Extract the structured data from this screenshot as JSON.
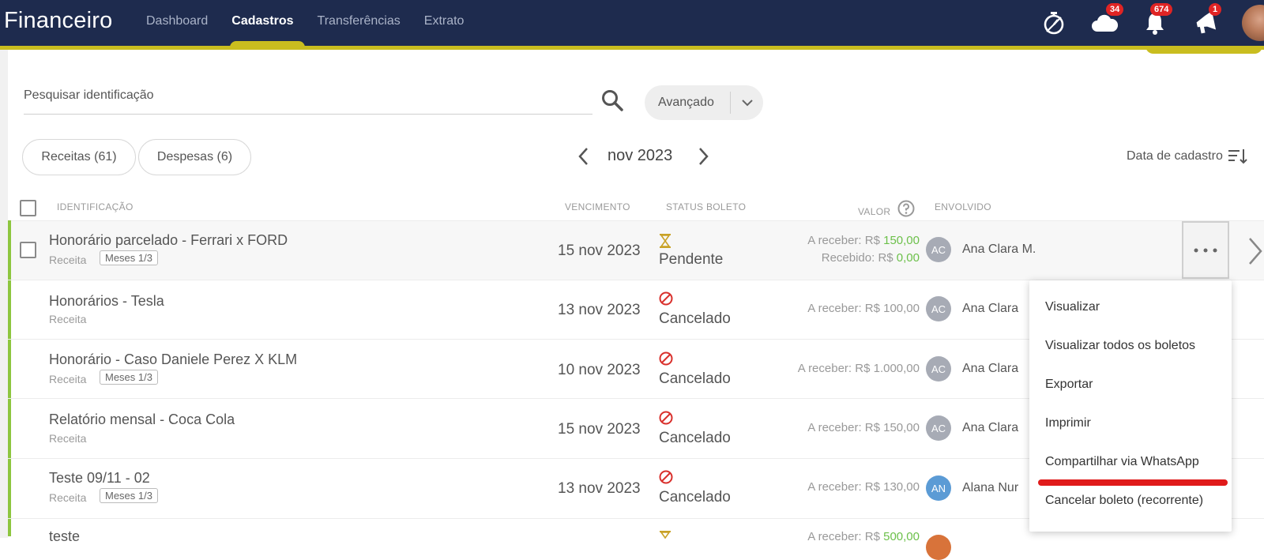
{
  "app": {
    "title": "Financeiro"
  },
  "nav": {
    "items": [
      "Dashboard",
      "Cadastros",
      "Transferências",
      "Extrato"
    ],
    "active": "Cadastros"
  },
  "topbar": {
    "cloud_badge": "34",
    "bell_badge": "674",
    "megaphone_badge": "1"
  },
  "search": {
    "placeholder": "Pesquisar identificação",
    "advanced_label": "Avançado"
  },
  "filters": {
    "receitas": "Receitas (61)",
    "despesas": "Despesas (6)"
  },
  "period": {
    "label": "nov 2023"
  },
  "sort": {
    "label": "Data de cadastro"
  },
  "table": {
    "headers": {
      "identificacao": "IDENTIFICAÇÃO",
      "vencimento": "VENCIMENTO",
      "status": "STATUS BOLETO",
      "valor": "VALOR",
      "envolvido": "ENVOLVIDO"
    },
    "rows": [
      {
        "title": "Honorário parcelado - Ferrari x FORD",
        "type": "Receita",
        "tag": "Meses 1/3",
        "date": "15 nov 2023",
        "status": "Pendente",
        "receber_label": "A receber: R$ ",
        "receber_value": "150,00",
        "recebido_label": "Recebido: R$ ",
        "recebido_value": "0,00",
        "initials": "AC",
        "name": "Ana Clara M."
      },
      {
        "title": "Honorários - Tesla",
        "type": "Receita",
        "tag": "",
        "date": "13 nov 2023",
        "status": "Cancelado",
        "receber": "A receber: R$ 100,00",
        "initials": "AC",
        "name": "Ana Clara"
      },
      {
        "title": "Honorário - Caso Daniele Perez X KLM",
        "type": "Receita",
        "tag": "Meses 1/3",
        "date": "10 nov 2023",
        "status": "Cancelado",
        "receber": "A receber: R$ 1.000,00",
        "initials": "AC",
        "name": "Ana Clara"
      },
      {
        "title": "Relatório mensal - Coca Cola",
        "type": "Receita",
        "tag": "",
        "date": "15 nov 2023",
        "status": "Cancelado",
        "receber": "A receber: R$ 150,00",
        "initials": "AC",
        "name": "Ana Clara"
      },
      {
        "title": "Teste 09/11 - 02",
        "type": "Receita",
        "tag": "Meses 1/3",
        "date": "13 nov 2023",
        "status": "Cancelado",
        "receber": "A receber: R$ 130,00",
        "initials": "AN",
        "name": "Alana Nur"
      },
      {
        "title": "teste",
        "receber_label": "A receber: R$ ",
        "receber_value": "500,00"
      }
    ]
  },
  "context_menu": {
    "items": [
      "Visualizar",
      "Visualizar todos os boletos",
      "Exportar",
      "Imprimir",
      "Compartilhar via WhatsApp",
      "Cancelar boleto (recorrente)"
    ]
  },
  "colors": {
    "topbar": "#1e2b4e",
    "accent": "#c9bd1f",
    "row_bar": "#8dc63f",
    "value_green": "#6cc04a",
    "highlight": "#e01b1b"
  }
}
